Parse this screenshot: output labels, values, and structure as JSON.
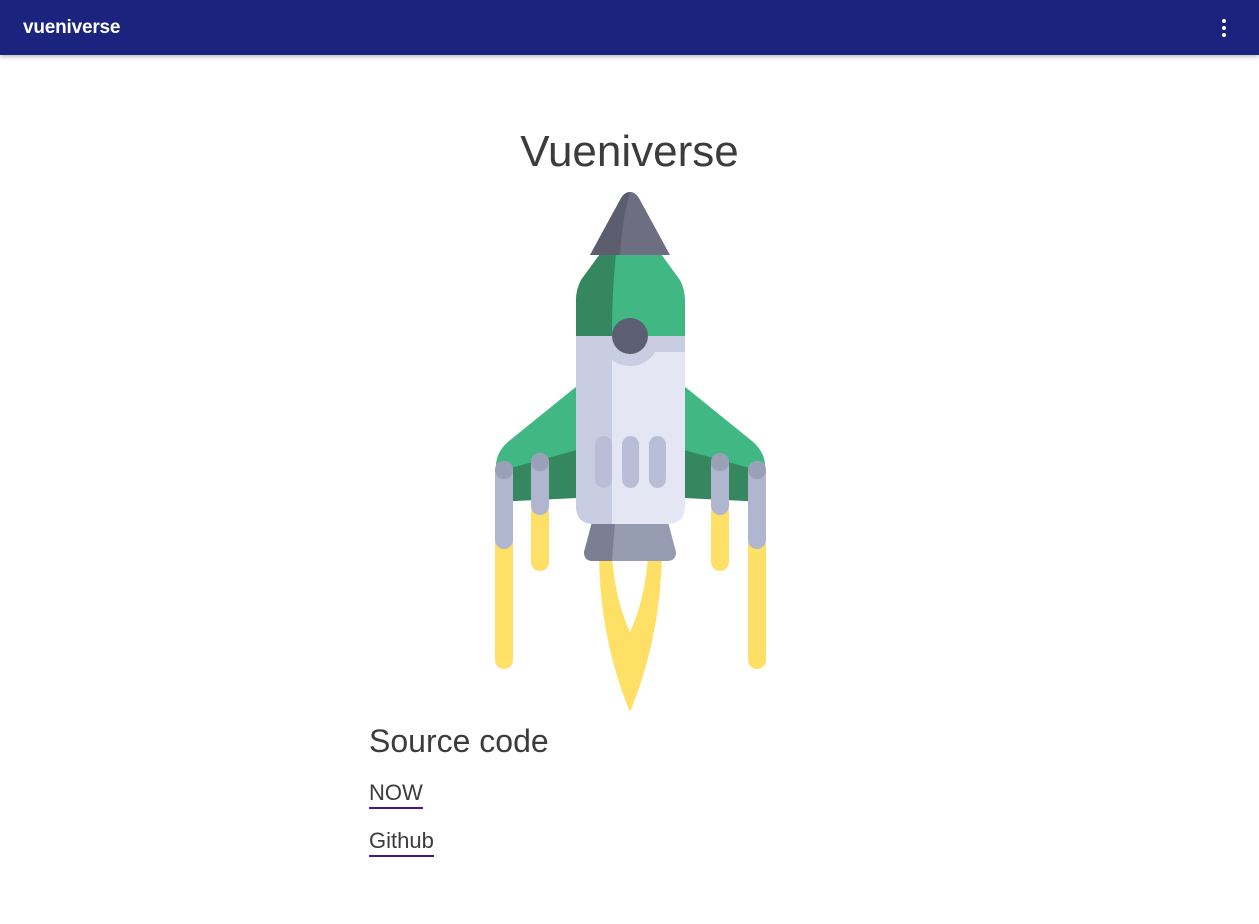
{
  "header": {
    "app_title": "vueniverse",
    "menu_icon": "more-vertical-icon"
  },
  "main": {
    "title": "Vueniverse",
    "illustration": "rocket-illustration",
    "source": {
      "heading": "Source code",
      "links": [
        {
          "label": "NOW"
        },
        {
          "label": "Github"
        }
      ]
    }
  },
  "colors": {
    "header_bg": "#1a237e",
    "text": "#3c3c3c",
    "link_underline": "#4a148c",
    "rocket_green": "#41b883",
    "rocket_dark_green": "#35875f",
    "rocket_nose": "#6e6e82",
    "rocket_body": "#e4e7f3",
    "flame": "#ffe066"
  }
}
